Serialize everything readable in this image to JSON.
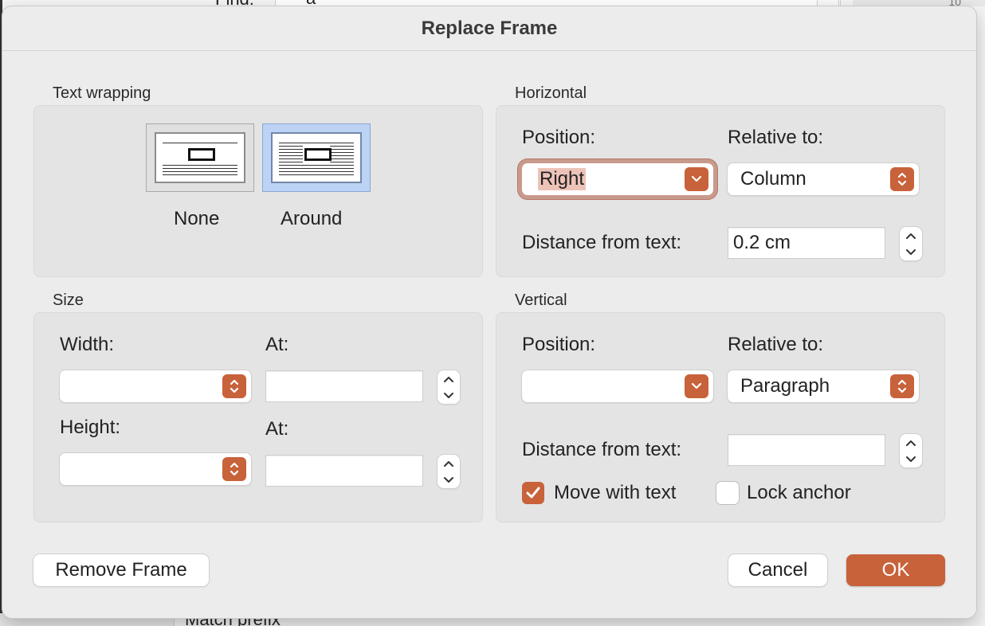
{
  "background": {
    "find_label": "Find:",
    "find_value": "a",
    "ruler_number": "10",
    "bottom_text": "Match prefix"
  },
  "dialog": {
    "title": "Replace Frame",
    "text_wrapping": {
      "label": "Text wrapping",
      "options": [
        {
          "label": "None",
          "selected": false
        },
        {
          "label": "Around",
          "selected": true
        }
      ]
    },
    "horizontal": {
      "label": "Horizontal",
      "position_label": "Position:",
      "position_value": "Right",
      "relative_label": "Relative to:",
      "relative_value": "Column",
      "distance_label": "Distance from text:",
      "distance_value": "0.2 cm"
    },
    "size": {
      "label": "Size",
      "width_label": "Width:",
      "width_value": "",
      "width_at_label": "At:",
      "width_at_value": "",
      "height_label": "Height:",
      "height_value": "",
      "height_at_label": "At:",
      "height_at_value": ""
    },
    "vertical": {
      "label": "Vertical",
      "position_label": "Position:",
      "position_value": "",
      "relative_label": "Relative to:",
      "relative_value": "Paragraph",
      "distance_label": "Distance from text:",
      "distance_value": "",
      "move_with_text_label": "Move with text",
      "move_with_text_checked": true,
      "lock_anchor_label": "Lock anchor",
      "lock_anchor_checked": false
    },
    "buttons": {
      "remove_frame": "Remove Frame",
      "cancel": "Cancel",
      "ok": "OK"
    }
  },
  "colors": {
    "accent": "#c8623a",
    "selection_blue": "#bcd3f6"
  }
}
